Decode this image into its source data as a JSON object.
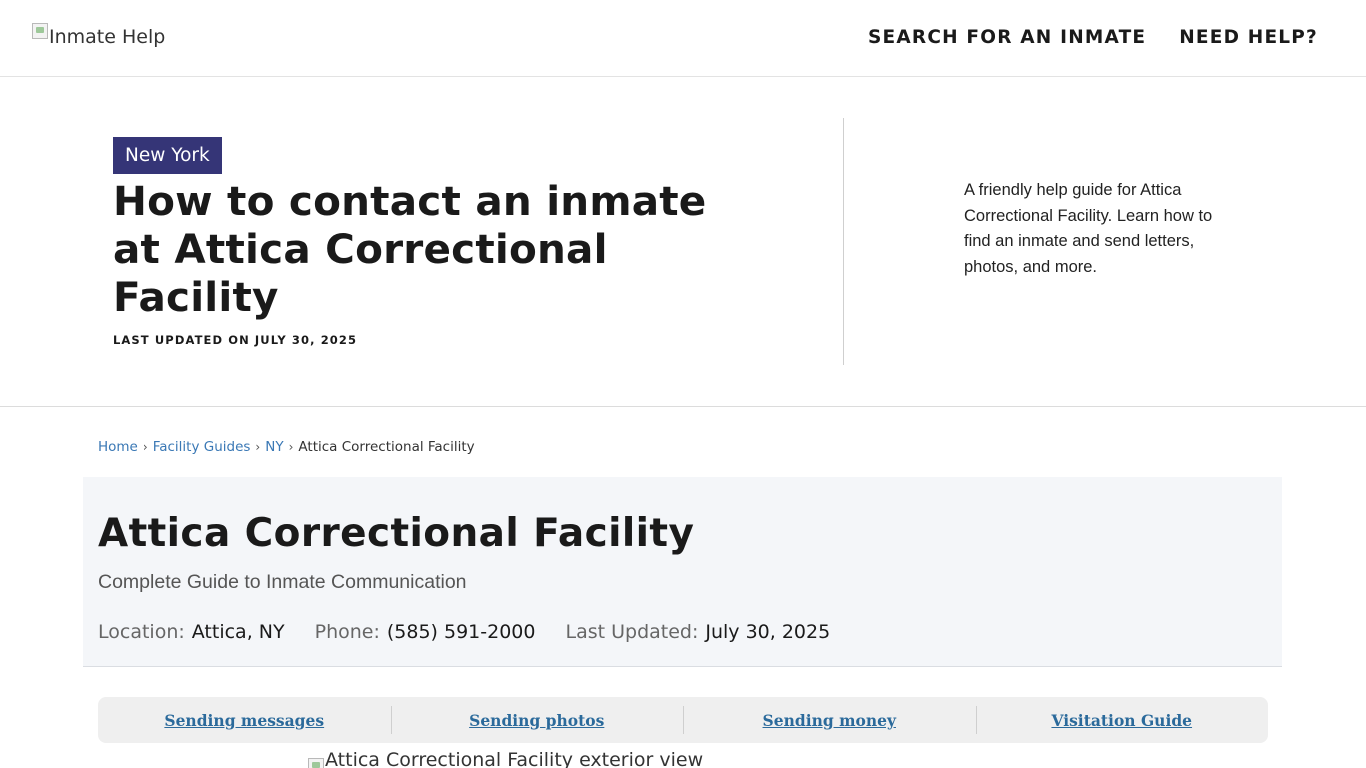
{
  "header": {
    "logo_alt": "Inmate Help",
    "nav": [
      {
        "label": "SEARCH FOR AN INMATE"
      },
      {
        "label": "NEED HELP?"
      }
    ]
  },
  "hero": {
    "state_badge": "New York",
    "title": "How to contact an inmate at Attica Correctional Facility",
    "last_updated": "LAST UPDATED ON JULY 30, 2025",
    "description": "A friendly help guide for Attica Correctional Facility. Learn how to find an inmate and send letters, photos, and more.",
    "badge_color": "#353577"
  },
  "breadcrumb": {
    "items": [
      {
        "label": "Home"
      },
      {
        "label": "Facility Guides"
      },
      {
        "label": "NY"
      }
    ],
    "current": "Attica Correctional Facility",
    "separator": "›"
  },
  "facility": {
    "name": "Attica Correctional Facility",
    "subtitle": "Complete Guide to Inmate Communication",
    "location_label": "Location:",
    "location_value": "Attica, NY",
    "phone_label": "Phone:",
    "phone_value": "(585) 591-2000",
    "updated_label": "Last Updated:",
    "updated_value": "July 30, 2025"
  },
  "guide_tabs": [
    {
      "label": "Sending messages"
    },
    {
      "label": "Sending photos"
    },
    {
      "label": "Sending money"
    },
    {
      "label": "Visitation Guide"
    }
  ],
  "exterior_image": {
    "alt": "Attica Correctional Facility exterior view"
  },
  "colors": {
    "link": "#3a78b5",
    "tab_link": "#2b6a9b",
    "panel_bg": "#f4f6f9"
  }
}
